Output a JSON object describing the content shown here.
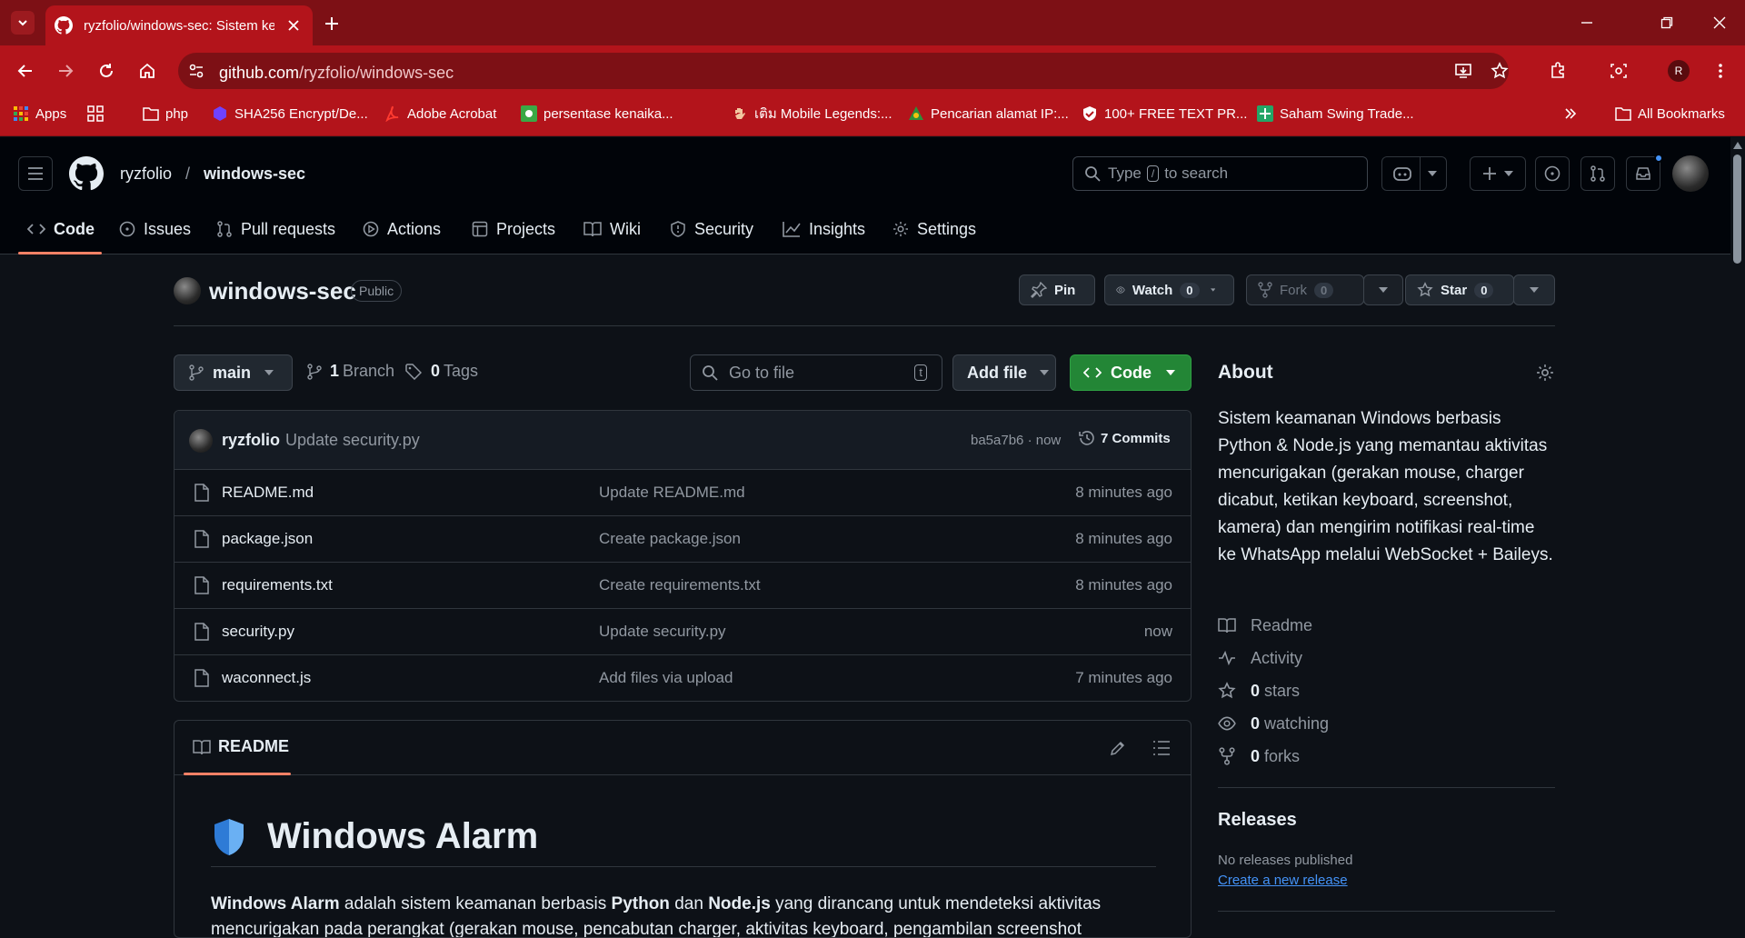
{
  "browser": {
    "tab_title": "ryzfolio/windows-sec: Sistem keamanan Windows",
    "url_host": "github.com",
    "url_path": "/ryzfolio/windows-sec",
    "profile_initial": "R"
  },
  "bookmarks": {
    "items": [
      {
        "label": "Apps",
        "icon": "apps-grid-icon"
      },
      {
        "label": "",
        "icon": "grid-icon"
      },
      {
        "label": "php",
        "icon": "folder-icon"
      },
      {
        "label": "SHA256 Encrypt/De...",
        "icon": "hexagon-icon"
      },
      {
        "label": "Adobe Acrobat",
        "icon": "acrobat-icon"
      },
      {
        "label": "persentase kenaika...",
        "icon": "calculator-icon"
      },
      {
        "label": "เติม Mobile Legends:...",
        "icon": "hand-icon"
      },
      {
        "label": "Pencarian alamat IP:...",
        "icon": "globe-icon"
      },
      {
        "label": "100+ FREE TEXT PR...",
        "icon": "shield-icon"
      },
      {
        "label": "Saham Swing Trade...",
        "icon": "sheets-icon"
      }
    ],
    "all_bookmarks": "All Bookmarks"
  },
  "github": {
    "owner": "ryzfolio",
    "separator": "/",
    "repo": "windows-sec",
    "search_prefix": "Type",
    "search_key": "/",
    "search_suffix": "to search",
    "tabs": [
      "Code",
      "Issues",
      "Pull requests",
      "Actions",
      "Projects",
      "Wiki",
      "Security",
      "Insights",
      "Settings"
    ]
  },
  "repo": {
    "name": "windows-sec",
    "visibility": "Public",
    "pin": "Pin",
    "watch": "Watch",
    "watch_count": "0",
    "fork": "Fork",
    "fork_count": "0",
    "star": "Star",
    "star_count": "0",
    "branch": "main",
    "branch_count": "1",
    "branch_label": "Branch",
    "tag_count": "0",
    "tag_label": "Tags",
    "goto_placeholder": "Go to file",
    "goto_key": "t",
    "add_file": "Add file",
    "code": "Code"
  },
  "commit": {
    "author": "ryzfolio",
    "message": "Update security.py",
    "hash_time": "ba5a7b6 · now",
    "commits": "7 Commits"
  },
  "files": [
    {
      "name": "README.md",
      "message": "Update README.md",
      "time": "8 minutes ago"
    },
    {
      "name": "package.json",
      "message": "Create package.json",
      "time": "8 minutes ago"
    },
    {
      "name": "requirements.txt",
      "message": "Create requirements.txt",
      "time": "8 minutes ago"
    },
    {
      "name": "security.py",
      "message": "Update security.py",
      "time": "now"
    },
    {
      "name": "waconnect.js",
      "message": "Add files via upload",
      "time": "7 minutes ago"
    }
  ],
  "readme": {
    "tab": "README",
    "heading": "Windows Alarm",
    "p_bold1": "Windows Alarm",
    "p_t1": " adalah sistem keamanan berbasis ",
    "p_bold2": "Python",
    "p_t2": " dan ",
    "p_bold3": "Node.js",
    "p_t3": " yang dirancang untuk mendeteksi aktivitas mencurigakan pada perangkat (gerakan mouse, pencabutan charger, aktivitas keyboard, pengambilan screenshot"
  },
  "about": {
    "heading": "About",
    "description": "Sistem keamanan Windows berbasis Python & Node.js yang memantau aktivitas mencurigakan (gerakan mouse, charger dicabut, ketikan keyboard, screenshot, kamera) dan mengirim notifikasi real-time ke WhatsApp melalui WebSocket + Baileys.",
    "readme": "Readme",
    "activity": "Activity",
    "stars_count": "0",
    "stars": "stars",
    "watching_count": "0",
    "watching": "watching",
    "forks_count": "0",
    "forks": "forks",
    "releases": "Releases",
    "no_releases": "No releases published",
    "create_release": "Create a new release"
  },
  "colors": {
    "chrome_dark": "#7d1015",
    "chrome": "#b3141b",
    "gh_bg": "#0d1117",
    "accent_underline": "#f78166",
    "green": "#238636",
    "link": "#4493f8"
  }
}
